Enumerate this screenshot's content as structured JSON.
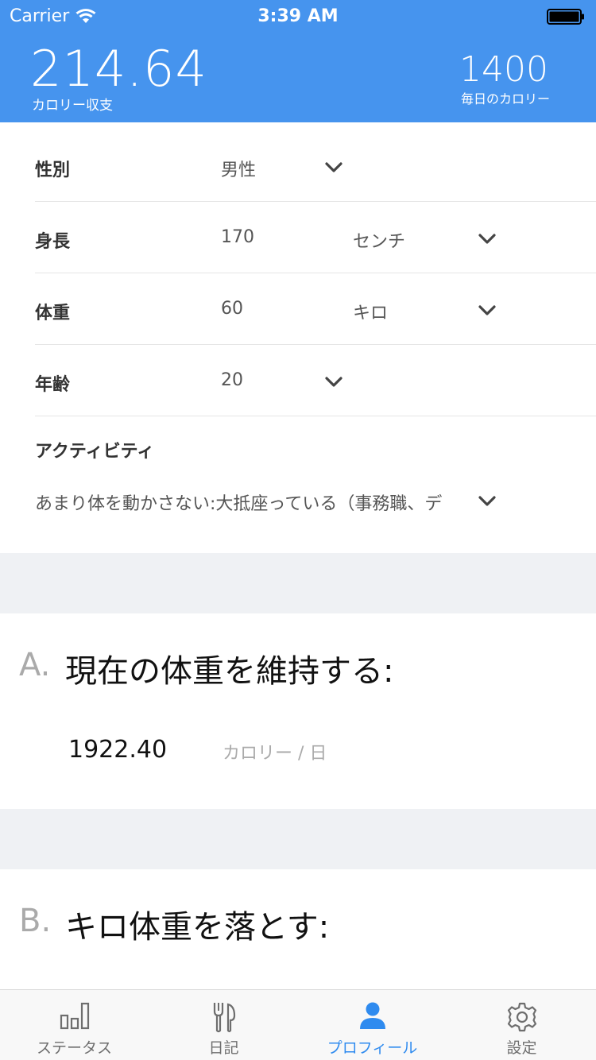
{
  "status_bar": {
    "carrier": "Carrier",
    "time": "3:39 AM"
  },
  "header": {
    "balance_value": "214.64",
    "balance_label": "カロリー収支",
    "daily_value": "1400",
    "daily_label": "毎日のカロリー",
    "color": "#4694ee"
  },
  "profile": {
    "gender": {
      "label": "性別",
      "value": "男性"
    },
    "height": {
      "label": "身長",
      "value": "170",
      "unit": "センチ"
    },
    "weight": {
      "label": "体重",
      "value": "60",
      "unit": "キロ"
    },
    "age": {
      "label": "年齢",
      "value": "20"
    },
    "activity": {
      "label": "アクティビティ",
      "value": "あまり体を動かさない:大抵座っている（事務職、デ"
    }
  },
  "section_a": {
    "letter": "A.",
    "title": "現在の体重を維持する:",
    "value": "1922.40",
    "unit": "カロリー / 日"
  },
  "section_b": {
    "letter": "B.",
    "title": "キロ体重を落とす:"
  },
  "tabbar": {
    "tabs": [
      {
        "label": "ステータス",
        "icon": "bar-chart-icon"
      },
      {
        "label": "日記",
        "icon": "fork-knife-icon"
      },
      {
        "label": "プロフィール",
        "icon": "person-icon",
        "active": true
      },
      {
        "label": "設定",
        "icon": "gear-icon"
      }
    ],
    "active_color": "#2f8bef"
  }
}
